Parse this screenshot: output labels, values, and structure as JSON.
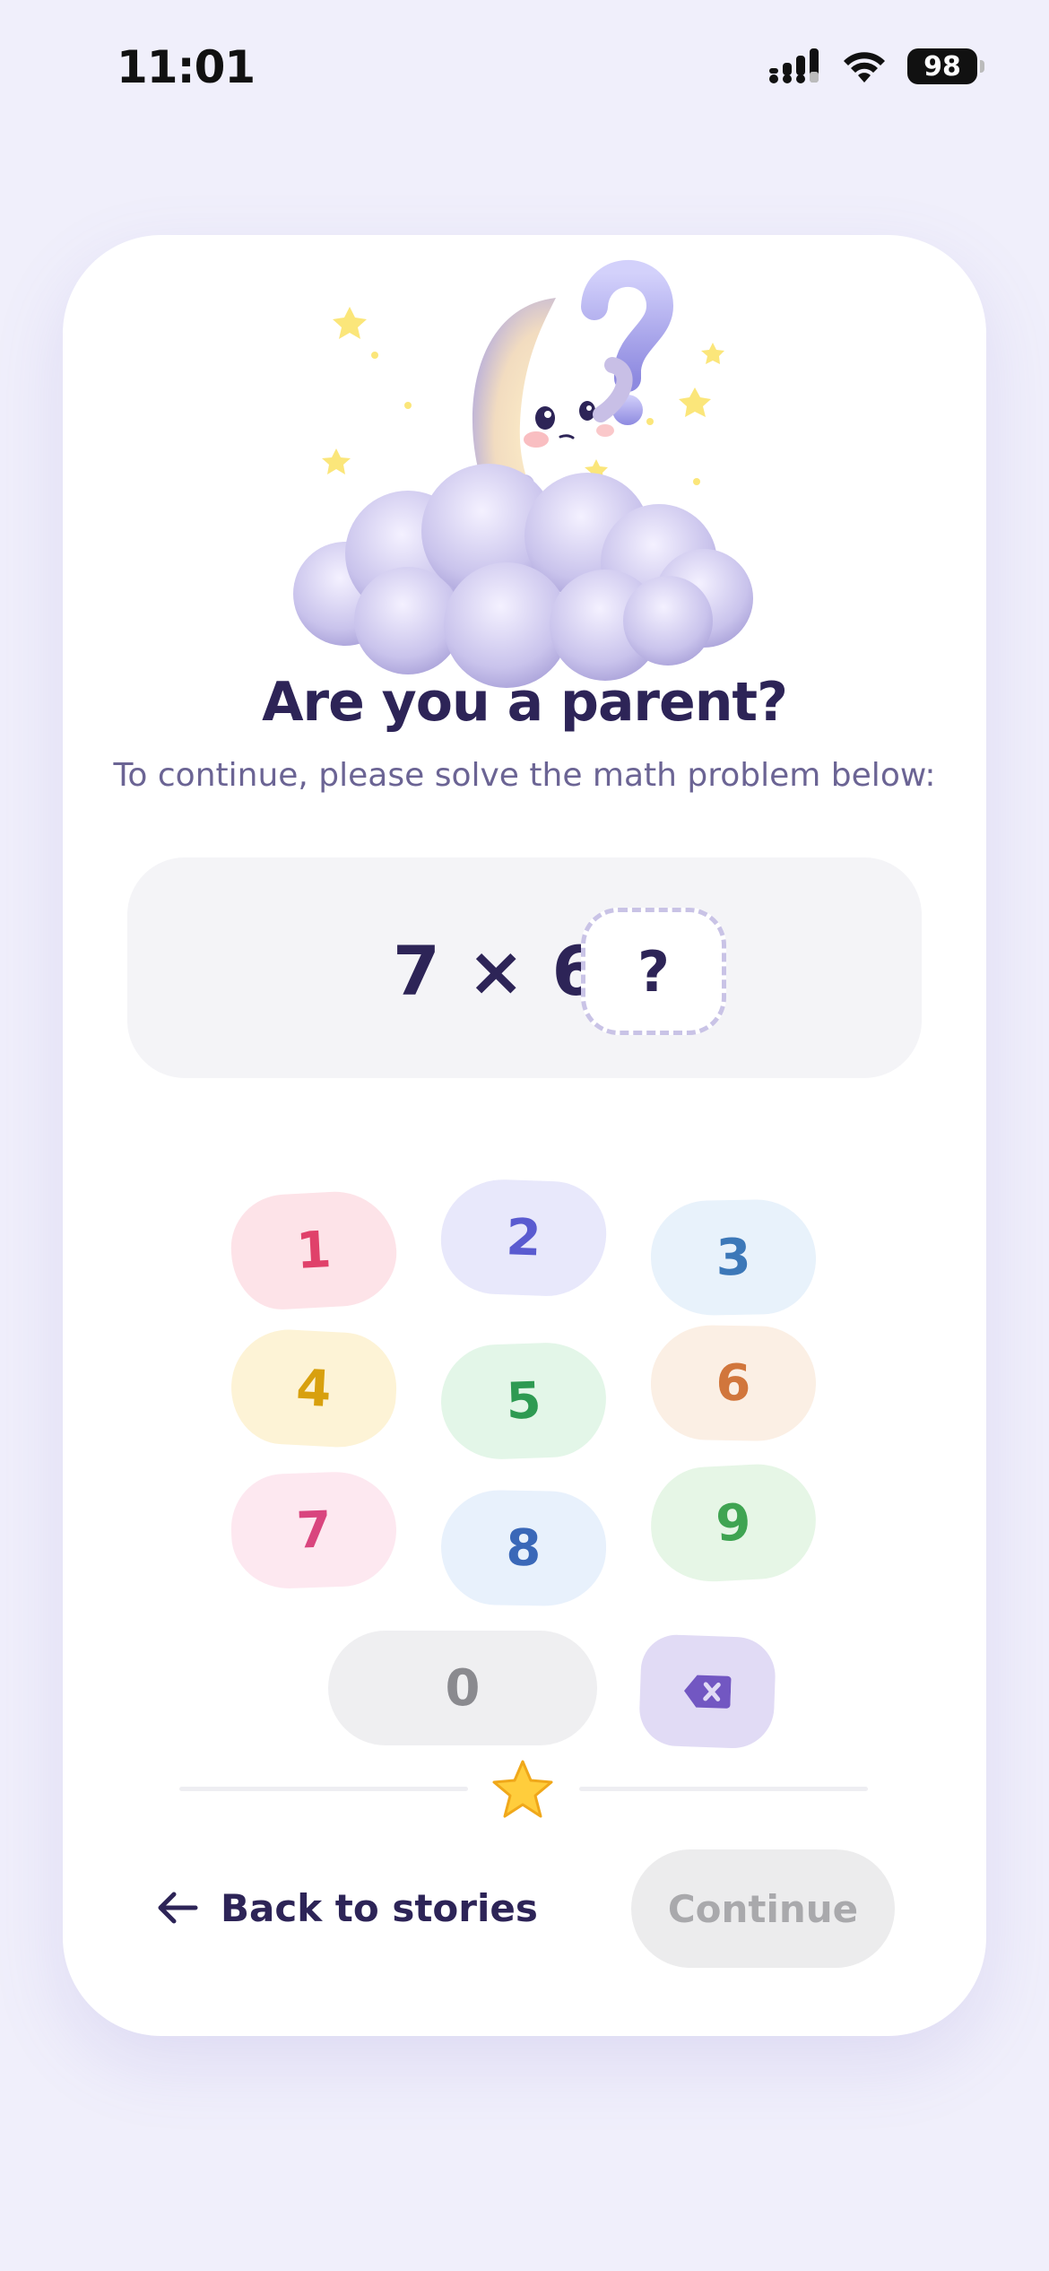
{
  "status_bar": {
    "time": "11:01",
    "battery": "98"
  },
  "prompt": {
    "title": "Are you a parent?",
    "subtitle": "To continue, please solve the math problem below:"
  },
  "problem": {
    "equation": "7 × 6 =",
    "answer_placeholder": "?"
  },
  "keypad": {
    "keys": [
      {
        "label": "1",
        "bg": "#fde3e8",
        "fg": "#e0416a"
      },
      {
        "label": "2",
        "bg": "#e8e8fb",
        "fg": "#5a5bd0"
      },
      {
        "label": "3",
        "bg": "#e8f2fb",
        "fg": "#3c78b8"
      },
      {
        "label": "4",
        "bg": "#fdf3d6",
        "fg": "#d8a00e"
      },
      {
        "label": "5",
        "bg": "#e3f6e8",
        "fg": "#2e9a52"
      },
      {
        "label": "6",
        "bg": "#fbefe4",
        "fg": "#d1763c"
      },
      {
        "label": "7",
        "bg": "#fde8f0",
        "fg": "#d9457e"
      },
      {
        "label": "8",
        "bg": "#e8f1fc",
        "fg": "#3a68b8"
      },
      {
        "label": "9",
        "bg": "#e6f6e6",
        "fg": "#3fa452"
      },
      {
        "label": "0",
        "bg": "#efeff1",
        "fg": "#8a8a8f"
      }
    ],
    "delete_icon": "backspace-icon"
  },
  "footer": {
    "back_label": "Back to stories",
    "continue_label": "Continue"
  },
  "colors": {
    "background": "#f0effb",
    "card": "#ffffff",
    "title": "#2d2457",
    "subtitle": "#6b6494",
    "delete_key": "#e1dbf5",
    "delete_icon": "#7257c2"
  }
}
